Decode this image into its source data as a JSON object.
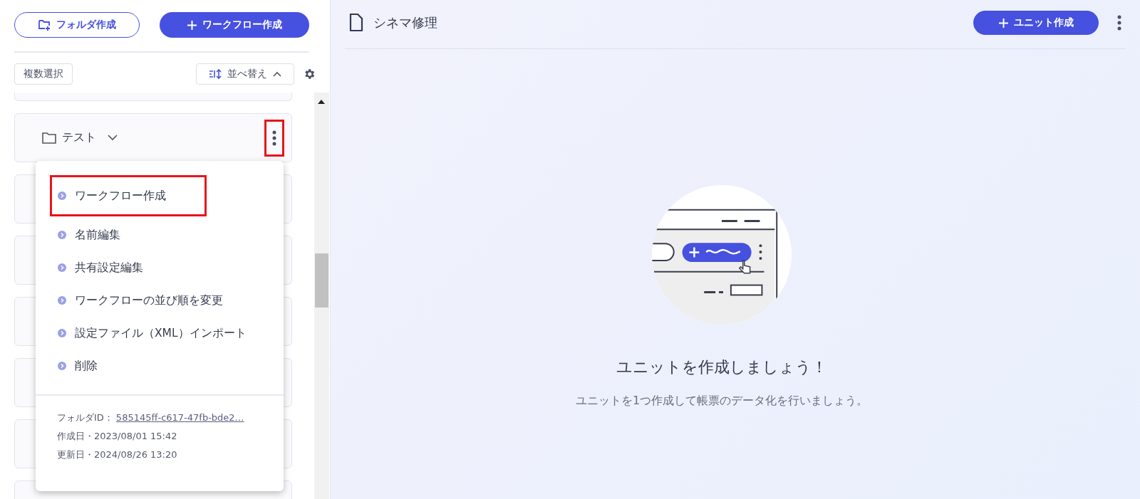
{
  "sidebar": {
    "create_folder_button": "フォルダ作成",
    "create_workflow_button": "ワークフロー作成",
    "multi_select_button": "複数選択",
    "sort_button": {
      "label": "並べ替え",
      "expanded": true
    },
    "folders": [
      {
        "name": "テスト",
        "expanded": false,
        "more_highlighted": true
      }
    ],
    "context_menu": {
      "items": [
        {
          "label": "ワークフロー作成",
          "highlighted": true
        },
        {
          "label": "名前編集",
          "highlighted": false
        },
        {
          "label": "共有設定編集",
          "highlighted": false
        },
        {
          "label": "ワークフローの並び順を変更",
          "highlighted": false
        },
        {
          "label": "設定ファイル（XML）インポート",
          "highlighted": false
        },
        {
          "label": "削除",
          "highlighted": false
        }
      ],
      "folder_id_label": "フォルダID：",
      "folder_id": "585145ff-c617-47fb-bde2…",
      "created": "作成日・2023/08/01 15:42",
      "updated": "更新日・2024/08/26 13:20"
    }
  },
  "main": {
    "title": "シネマ修理",
    "create_unit_button": "ユニット作成",
    "empty_title": "ユニットを作成しましょう！",
    "empty_message": "ユニットを1つ作成して帳票のデータ化を行いましょう。"
  }
}
